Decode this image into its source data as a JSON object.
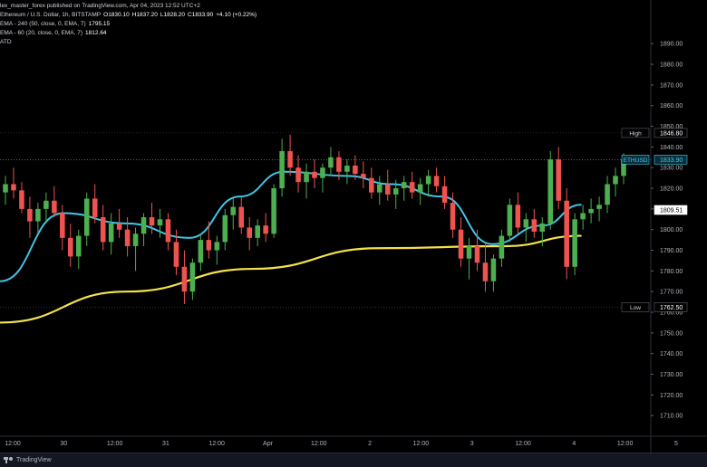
{
  "header": {
    "publisher_line": "lex_master_forex published on TradingView.com, Apr 04, 2023 12:52 UTC+2",
    "symbol_line": "Ethereum / U.S. Dollar, 1h, BITSTAMP",
    "ohlc": {
      "o": "O1830.10",
      "h": "H1837.20",
      "l": "L1828.20",
      "c": "C1833.90",
      "chg": "+4.10 (+0.22%)"
    },
    "ema240_label": "EMA - 240 (50, close, 0, EMA, 7)",
    "ema240_value": "1795.15",
    "ema60_label": "EMA - 60 (20, close, 0, EMA, 7)",
    "ema60_value": "1812.64",
    "atd_label": "ATD"
  },
  "footer": {
    "brand": "TradingView"
  },
  "colors": {
    "bull": "#26a69a",
    "bull_bright": "#4caf50",
    "bear": "#ef5350",
    "ema_fast": "#3fc6e8",
    "ema_slow": "#f5e14a",
    "ema_thin": "#c0c0c0",
    "axis_text": "#b2b5be",
    "ethusd_tag": "#3fc6e8"
  },
  "chart_data": {
    "type": "candlestick",
    "symbol": "ETHUSD",
    "timeframe": "1h",
    "ylim": [
      1700,
      1905
    ],
    "y_ticks": [
      1710,
      1720,
      1730,
      1740,
      1750,
      1760,
      1770,
      1780,
      1790,
      1800,
      1810,
      1820,
      1830,
      1840,
      1850,
      1860,
      1870,
      1880,
      1890
    ],
    "x_ticks": [
      "12:00",
      "30",
      "12:00",
      "31",
      "12:00",
      "Apr",
      "12:00",
      "2",
      "12:00",
      "3",
      "12:00",
      "4",
      "12:00",
      "5"
    ],
    "price_tags": [
      {
        "label": "High",
        "value": "1846.80",
        "price": 1846.8,
        "style": "outline"
      },
      {
        "label": "ETHUSD",
        "value": "1833.90",
        "price": 1833.9,
        "style": "current"
      },
      {
        "label": "",
        "value": "1809.51",
        "price": 1809.51,
        "style": "plain"
      },
      {
        "label": "Low",
        "value": "1762.50",
        "price": 1762.5,
        "style": "outline"
      }
    ],
    "ema240_line": {
      "name": "EMA - 240",
      "x_frac": [
        0.0,
        0.2,
        0.4,
        0.6,
        0.8,
        0.92
      ],
      "values": [
        1755,
        1770,
        1781,
        1791,
        1792,
        1797
      ]
    },
    "ema60_line": {
      "name": "EMA - 60",
      "x_frac": [
        0.0,
        0.1,
        0.2,
        0.3,
        0.38,
        0.45,
        0.55,
        0.62,
        0.7,
        0.78,
        0.86,
        0.92
      ],
      "values": [
        1775,
        1808,
        1803,
        1796,
        1816,
        1828,
        1826,
        1822,
        1816,
        1793,
        1802,
        1812
      ]
    },
    "candles": [
      [
        1818,
        1826,
        1812,
        1822
      ],
      [
        1822,
        1830,
        1815,
        1819
      ],
      [
        1819,
        1823,
        1808,
        1810
      ],
      [
        1810,
        1816,
        1796,
        1804
      ],
      [
        1804,
        1813,
        1798,
        1810
      ],
      [
        1810,
        1818,
        1803,
        1814
      ],
      [
        1814,
        1821,
        1806,
        1808
      ],
      [
        1808,
        1812,
        1790,
        1796
      ],
      [
        1796,
        1803,
        1782,
        1787
      ],
      [
        1787,
        1800,
        1781,
        1797
      ],
      [
        1797,
        1818,
        1792,
        1815
      ],
      [
        1815,
        1822,
        1803,
        1806
      ],
      [
        1806,
        1812,
        1790,
        1794
      ],
      [
        1794,
        1808,
        1788,
        1803
      ],
      [
        1803,
        1810,
        1796,
        1800
      ],
      [
        1800,
        1806,
        1787,
        1792
      ],
      [
        1792,
        1801,
        1780,
        1798
      ],
      [
        1798,
        1808,
        1792,
        1806
      ],
      [
        1806,
        1813,
        1798,
        1802
      ],
      [
        1802,
        1810,
        1796,
        1805
      ],
      [
        1805,
        1808,
        1790,
        1794
      ],
      [
        1794,
        1800,
        1778,
        1782
      ],
      [
        1782,
        1790,
        1764,
        1770
      ],
      [
        1770,
        1786,
        1766,
        1784
      ],
      [
        1784,
        1798,
        1780,
        1795
      ],
      [
        1795,
        1804,
        1786,
        1790
      ],
      [
        1790,
        1797,
        1783,
        1794
      ],
      [
        1794,
        1810,
        1790,
        1807
      ],
      [
        1807,
        1815,
        1800,
        1811
      ],
      [
        1811,
        1816,
        1798,
        1801
      ],
      [
        1801,
        1806,
        1790,
        1796
      ],
      [
        1796,
        1805,
        1792,
        1802
      ],
      [
        1802,
        1808,
        1794,
        1798
      ],
      [
        1798,
        1822,
        1796,
        1820
      ],
      [
        1820,
        1844,
        1816,
        1838
      ],
      [
        1838,
        1846,
        1826,
        1830
      ],
      [
        1830,
        1836,
        1818,
        1823
      ],
      [
        1823,
        1832,
        1815,
        1828
      ],
      [
        1828,
        1834,
        1820,
        1825
      ],
      [
        1825,
        1832,
        1818,
        1830
      ],
      [
        1830,
        1840,
        1826,
        1835
      ],
      [
        1835,
        1838,
        1824,
        1828
      ],
      [
        1828,
        1834,
        1822,
        1831
      ],
      [
        1831,
        1836,
        1824,
        1827
      ],
      [
        1827,
        1833,
        1820,
        1825
      ],
      [
        1825,
        1830,
        1815,
        1818
      ],
      [
        1818,
        1826,
        1812,
        1822
      ],
      [
        1822,
        1829,
        1814,
        1817
      ],
      [
        1817,
        1824,
        1810,
        1820
      ],
      [
        1820,
        1826,
        1814,
        1823
      ],
      [
        1823,
        1828,
        1815,
        1818
      ],
      [
        1818,
        1825,
        1812,
        1822
      ],
      [
        1822,
        1829,
        1816,
        1826
      ],
      [
        1826,
        1830,
        1818,
        1821
      ],
      [
        1821,
        1826,
        1810,
        1813
      ],
      [
        1813,
        1818,
        1796,
        1800
      ],
      [
        1800,
        1806,
        1782,
        1786
      ],
      [
        1786,
        1796,
        1776,
        1792
      ],
      [
        1792,
        1800,
        1780,
        1784
      ],
      [
        1784,
        1794,
        1770,
        1775
      ],
      [
        1775,
        1788,
        1770,
        1786
      ],
      [
        1786,
        1800,
        1782,
        1797
      ],
      [
        1797,
        1815,
        1794,
        1812
      ],
      [
        1812,
        1818,
        1798,
        1801
      ],
      [
        1801,
        1808,
        1794,
        1805
      ],
      [
        1805,
        1810,
        1796,
        1799
      ],
      [
        1799,
        1806,
        1792,
        1803
      ],
      [
        1803,
        1838,
        1800,
        1834
      ],
      [
        1834,
        1840,
        1810,
        1814
      ],
      [
        1814,
        1820,
        1776,
        1782
      ],
      [
        1782,
        1808,
        1778,
        1805
      ],
      [
        1805,
        1812,
        1800,
        1808
      ],
      [
        1808,
        1815,
        1803,
        1810
      ],
      [
        1810,
        1816,
        1804,
        1812
      ],
      [
        1812,
        1826,
        1808,
        1822
      ],
      [
        1822,
        1830,
        1816,
        1826
      ],
      [
        1826,
        1837,
        1822,
        1834
      ]
    ]
  }
}
